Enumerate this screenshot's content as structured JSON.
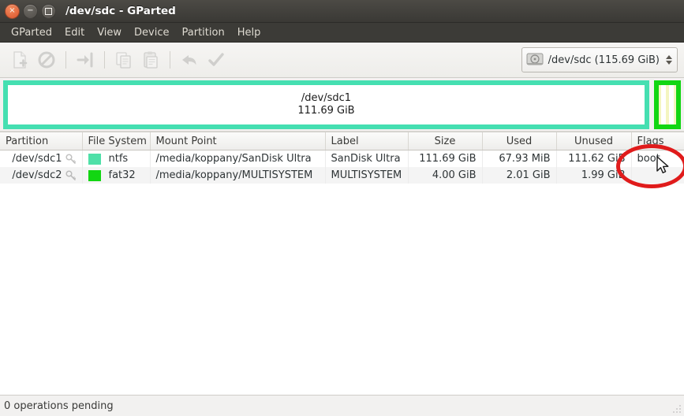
{
  "window": {
    "title": "/dev/sdc - GParted",
    "controls": [
      {
        "name": "close",
        "glyph": "×"
      },
      {
        "name": "minimize",
        "glyph": "−"
      },
      {
        "name": "maximize",
        "glyph": "□"
      }
    ]
  },
  "menubar": {
    "items": [
      {
        "label": "GParted"
      },
      {
        "label": "Edit"
      },
      {
        "label": "View"
      },
      {
        "label": "Device"
      },
      {
        "label": "Partition"
      },
      {
        "label": "Help"
      }
    ]
  },
  "toolbar": {
    "buttons": [
      {
        "name": "new-partition-icon",
        "tooltip": "New"
      },
      {
        "name": "delete-partition-icon",
        "tooltip": "Delete"
      },
      {
        "name": "resize-move-icon",
        "tooltip": "Resize/Move"
      },
      {
        "name": "copy-icon",
        "tooltip": "Copy"
      },
      {
        "name": "paste-icon",
        "tooltip": "Paste"
      },
      {
        "name": "undo-icon",
        "tooltip": "Undo"
      },
      {
        "name": "apply-icon",
        "tooltip": "Apply All Operations"
      }
    ],
    "device_selector": {
      "icon": "hard-disk-icon",
      "value": "/dev/sdc  (115.69 GiB)"
    }
  },
  "graphic": {
    "partitions": [
      {
        "name": "/dev/sdc1",
        "size": "111.69 GiB",
        "border_color": "#45dfb1",
        "fill_color": "#ffffff"
      },
      {
        "name": "/dev/sdc2",
        "size": "4.00 GiB",
        "border_color": "#12d612",
        "fill_color": "#f4f5c0"
      }
    ]
  },
  "table": {
    "columns": [
      {
        "key": "partition",
        "label": "Partition"
      },
      {
        "key": "filesystem",
        "label": "File System"
      },
      {
        "key": "mountpoint",
        "label": "Mount Point"
      },
      {
        "key": "label",
        "label": "Label"
      },
      {
        "key": "size",
        "label": "Size"
      },
      {
        "key": "used",
        "label": "Used"
      },
      {
        "key": "unused",
        "label": "Unused"
      },
      {
        "key": "flags",
        "label": "Flags"
      }
    ],
    "rows": [
      {
        "partition": "/dev/sdc1",
        "filesystem": "ntfs",
        "fs_color": "#4fe0a8",
        "mountpoint": "/media/koppany/SanDisk Ultra",
        "label": "SanDisk Ultra",
        "size": "111.69 GiB",
        "used": "67.93 MiB",
        "unused": "111.62 GiB",
        "flags": "boot"
      },
      {
        "partition": "/dev/sdc2",
        "filesystem": "fat32",
        "fs_color": "#12d612",
        "mountpoint": "/media/koppany/MULTISYSTEM",
        "label": "MULTISYSTEM",
        "size": "4.00 GiB",
        "used": "2.01 GiB",
        "unused": "1.99 GiB",
        "flags": ""
      }
    ]
  },
  "annotation": {
    "shape": "ellipse",
    "color": "#e01b1b",
    "target": "flags-cell-boot"
  },
  "statusbar": {
    "text": "0 operations pending"
  }
}
